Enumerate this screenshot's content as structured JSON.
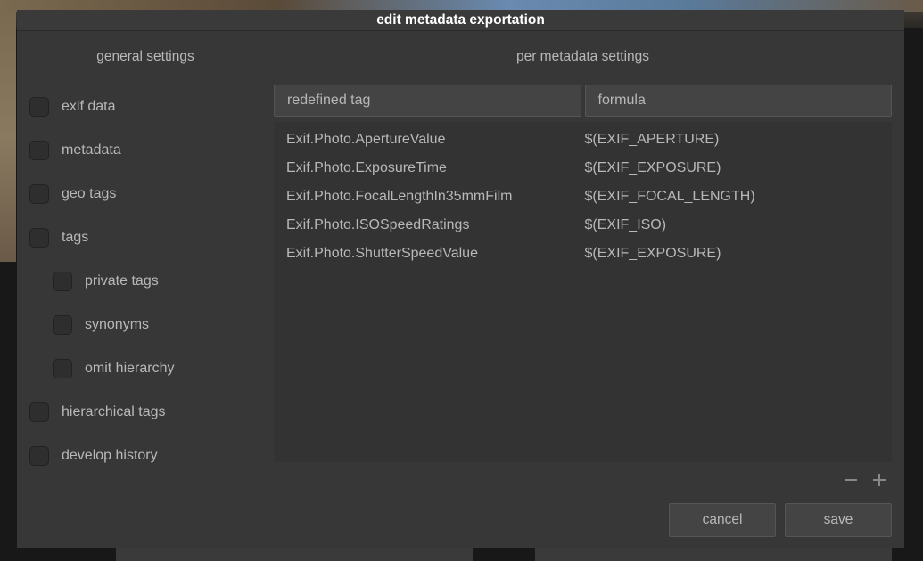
{
  "dialog": {
    "title": "edit metadata exportation"
  },
  "left": {
    "heading": "general settings",
    "items": [
      {
        "label": "exif data",
        "indent": 0
      },
      {
        "label": "metadata",
        "indent": 0
      },
      {
        "label": "geo tags",
        "indent": 0
      },
      {
        "label": "tags",
        "indent": 0
      },
      {
        "label": "private tags",
        "indent": 1
      },
      {
        "label": "synonyms",
        "indent": 1
      },
      {
        "label": "omit hierarchy",
        "indent": 1
      },
      {
        "label": "hierarchical tags",
        "indent": 0
      },
      {
        "label": "develop history",
        "indent": 0
      }
    ]
  },
  "right": {
    "heading": "per metadata settings",
    "col_tag": "redefined tag",
    "col_formula": "formula",
    "rows": [
      {
        "tag": "Exif.Photo.ApertureValue",
        "formula": "$(EXIF_APERTURE)"
      },
      {
        "tag": "Exif.Photo.ExposureTime",
        "formula": "$(EXIF_EXPOSURE)"
      },
      {
        "tag": "Exif.Photo.FocalLengthIn35mmFilm",
        "formula": "$(EXIF_FOCAL_LENGTH)"
      },
      {
        "tag": "Exif.Photo.ISOSpeedRatings",
        "formula": "$(EXIF_ISO)"
      },
      {
        "tag": "Exif.Photo.ShutterSpeedValue",
        "formula": "$(EXIF_EXPOSURE)"
      }
    ]
  },
  "footer": {
    "cancel": "cancel",
    "save": "save"
  }
}
